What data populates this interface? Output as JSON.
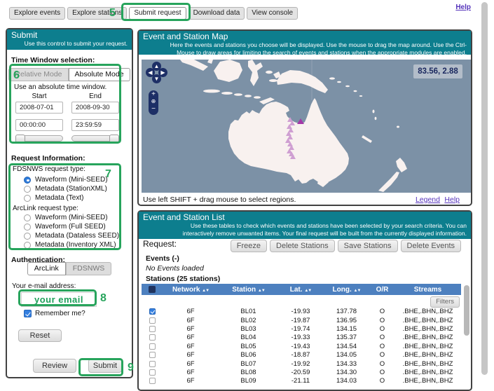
{
  "tabs": {
    "items": [
      {
        "label": "Explore events",
        "active": false
      },
      {
        "label": "Explore stations",
        "active": false
      },
      {
        "label": "Submit request",
        "active": true
      },
      {
        "label": "Download data",
        "active": false
      },
      {
        "label": "View console",
        "active": false
      }
    ],
    "help_link": "Help"
  },
  "submit_panel": {
    "title": "Submit",
    "subtitle": "Use this control to submit your request.",
    "time_window_label": "Time Window selection:",
    "relative_mode_label": "Relative Mode",
    "absolute_mode_label": "Absolute Mode",
    "absolute_hint": "Use an absolute time window.",
    "start_label": "Start",
    "end_label": "End",
    "start_date": "2008-07-01",
    "end_date": "2008-09-30",
    "start_time": "00:00:00",
    "end_time": "23:59:59",
    "request_info_label": "Request Information:",
    "fdsnws_group_label": "FDSNWS request type:",
    "fdsnws_options": [
      {
        "label": "Waveform (Mini-SEED)",
        "selected": true
      },
      {
        "label": "Metadata (StationXML)",
        "selected": false
      },
      {
        "label": "Metadata (Text)",
        "selected": false
      }
    ],
    "arclink_group_label": "ArcLink request type:",
    "arclink_options": [
      {
        "label": "Waveform (Mini-SEED)",
        "selected": false
      },
      {
        "label": "Waveform (Full SEED)",
        "selected": false
      },
      {
        "label": "Metadata (Dataless SEED)",
        "selected": false
      },
      {
        "label": "Metadata (Inventory XML)",
        "selected": false
      }
    ],
    "auth_label": "Authentication:",
    "auth_buttons": [
      {
        "label": "ArcLink",
        "active": true
      },
      {
        "label": "FDSNWS",
        "active": false
      }
    ],
    "email_label": "Your e-mail address:",
    "email_value": "your email",
    "remember_label": "Remember me?",
    "remember_checked": true,
    "reset_label": "Reset",
    "review_label": "Review",
    "submit_label": "Submit"
  },
  "map_panel": {
    "title": "Event and Station Map",
    "subtitle": "Here the events and stations you choose will be displayed. Use the mouse to drag the map around. Use the Ctrl-Mouse to draw areas for limiting the search of events and stations when the appropriate modules are enabled.",
    "coordinates": "83.56, 2.88",
    "hint": "Use left SHIFT + drag mouse to select regions.",
    "legend_link": "Legend",
    "help_link": "Help",
    "ocean_color": "#7c91a6",
    "land_color": "#f8f1ef",
    "station_color": "#cf9fd2",
    "event_color": "#a438a8"
  },
  "list_panel": {
    "title": "Event and Station List",
    "subtitle": "Use these tables to check which events and stations have been selected by your search criteria. You can interactively remove unwanted items. Your final request will be built from the currently displayed information.",
    "request_label": "Request:",
    "action_buttons": [
      "Freeze",
      "Delete Stations",
      "Save Stations",
      "Delete Events"
    ],
    "events_label": "Events (-)",
    "events_empty": "No Events loaded",
    "stations_label": "Stations (25 stations)",
    "filters_label": "Filters",
    "table": {
      "headers": [
        {
          "label": "Network",
          "sortable": true
        },
        {
          "label": "Station",
          "sortable": true
        },
        {
          "label": "Lat.",
          "sortable": true
        },
        {
          "label": "Long.",
          "sortable": true
        },
        {
          "label": "O/R",
          "sortable": false
        },
        {
          "label": "Streams",
          "sortable": false
        }
      ],
      "rows": [
        {
          "checked": true,
          "network": "6F",
          "station": "BL01",
          "lat": "-19.93",
          "long": "137.78",
          "or": "O",
          "streams": ".BHE,.BHN,.BHZ"
        },
        {
          "checked": false,
          "network": "6F",
          "station": "BL02",
          "lat": "-19.87",
          "long": "136.95",
          "or": "O",
          "streams": ".BHE,.BHN,.BHZ"
        },
        {
          "checked": false,
          "network": "6F",
          "station": "BL03",
          "lat": "-19.74",
          "long": "134.15",
          "or": "O",
          "streams": ".BHE,.BHN,.BHZ"
        },
        {
          "checked": false,
          "network": "6F",
          "station": "BL04",
          "lat": "-19.33",
          "long": "135.37",
          "or": "O",
          "streams": ".BHE,.BHN,.BHZ"
        },
        {
          "checked": false,
          "network": "6F",
          "station": "BL05",
          "lat": "-19.43",
          "long": "134.54",
          "or": "O",
          "streams": ".BHE,.BHN,.BHZ"
        },
        {
          "checked": false,
          "network": "6F",
          "station": "BL06",
          "lat": "-18.87",
          "long": "134.05",
          "or": "O",
          "streams": ".BHE,.BHN,.BHZ"
        },
        {
          "checked": false,
          "network": "6F",
          "station": "BL07",
          "lat": "-19.92",
          "long": "134.33",
          "or": "O",
          "streams": ".BHE,.BHN,.BHZ"
        },
        {
          "checked": false,
          "network": "6F",
          "station": "BL08",
          "lat": "-20.59",
          "long": "134.30",
          "or": "O",
          "streams": ".BHE,.BHN,.BHZ"
        },
        {
          "checked": false,
          "network": "6F",
          "station": "BL09",
          "lat": "-21.11",
          "long": "134.03",
          "or": "O",
          "streams": ".BHE,.BHN,.BHZ"
        }
      ]
    }
  },
  "annotations": {
    "tab_number": "5",
    "time_number": "6",
    "request_number": "7",
    "email_number": "8",
    "submit_number": "9",
    "color": "#27a45c"
  }
}
